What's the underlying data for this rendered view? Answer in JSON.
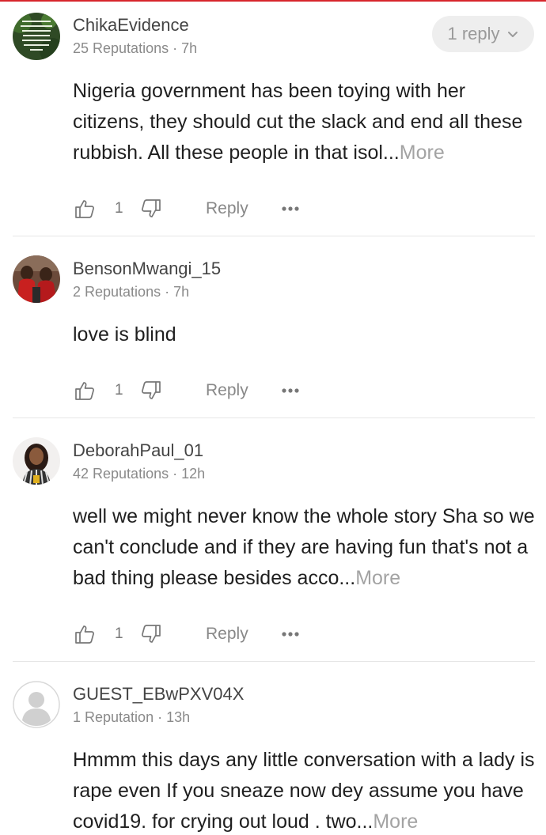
{
  "comments": [
    {
      "username": "ChikaEvidence",
      "meta": "25 Reputations · 7h",
      "text": "Nigeria government has been toying with her citizens, they should cut the slack and end all these rubbish. All these people in that isol...",
      "more_label": "More",
      "likes": "1",
      "reply_label": "Reply",
      "replies_label": "1 reply",
      "avatar_text": "THE ONLY PERSON YOU ARE DESTINED TO BECOME IS THE PERSON YOU DECIDE TO BE"
    },
    {
      "username": "BensonMwangi_15",
      "meta": "2 Reputations · 7h",
      "text": "love is blind",
      "likes": "1",
      "reply_label": "Reply"
    },
    {
      "username": "DeborahPaul_01",
      "meta": "42 Reputations · 12h",
      "text": "well we might never know the whole story Sha so we can't conclude and if they are having fun that's not a bad thing please besides acco...",
      "more_label": "More",
      "likes": "1",
      "reply_label": "Reply"
    },
    {
      "username": "GUEST_EBwPXV04X",
      "meta": "1 Reputation · 13h",
      "text": "Hmmm this days any little conversation with a lady is rape even If you sneaze now dey assume you have covid19. for crying out loud . two...",
      "more_label": "More"
    }
  ],
  "icons": {
    "like": "thumbs-up-icon",
    "dislike": "thumbs-down-icon",
    "more": "more-dots-icon",
    "expand": "chevron-down-icon"
  },
  "colors": {
    "accent_line": "#d7262c",
    "more_link": "#a3a3a3",
    "meta_text": "#8a8a8a"
  }
}
